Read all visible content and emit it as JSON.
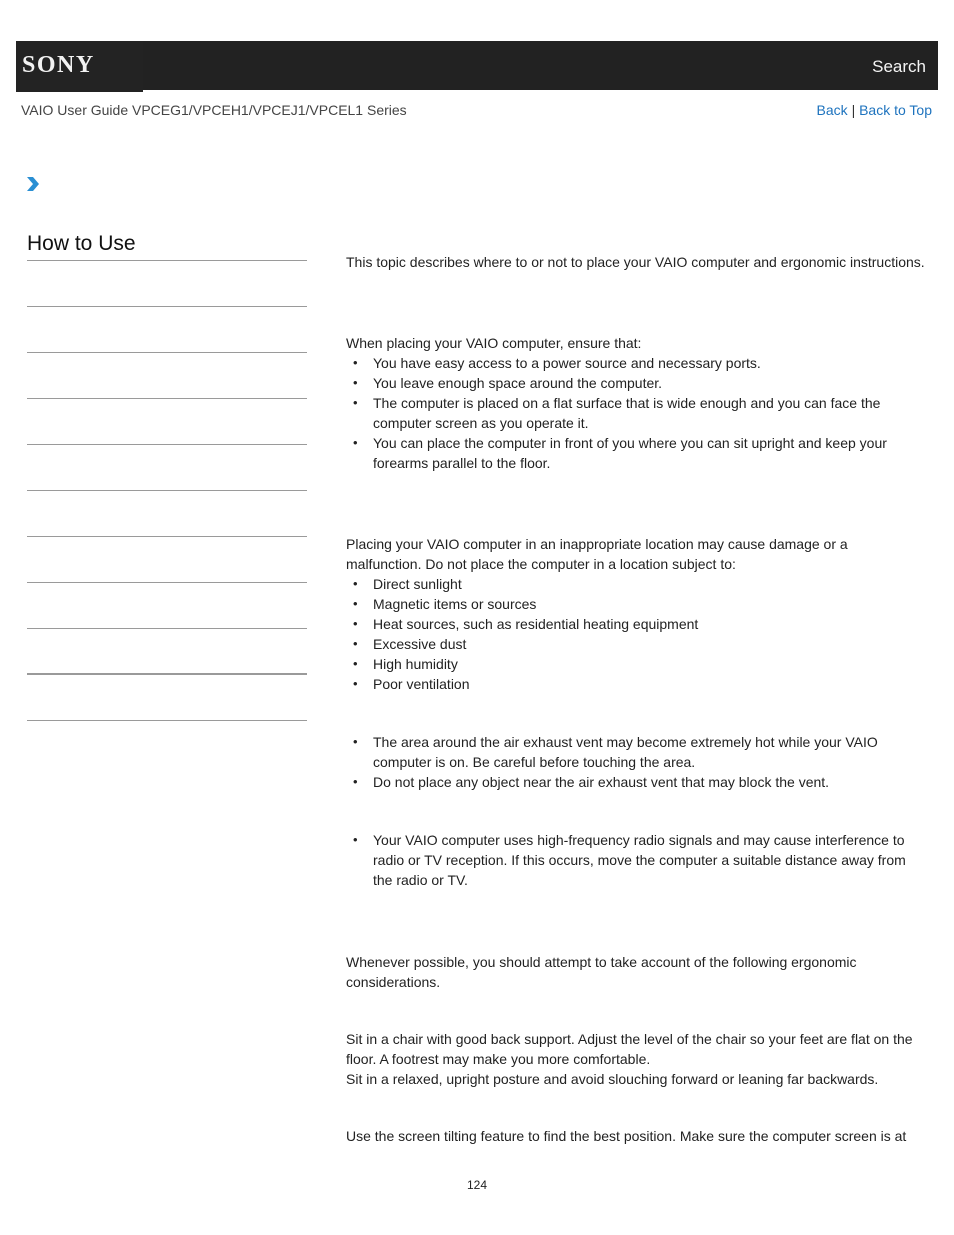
{
  "header": {
    "logo": "SONY",
    "search_label": "Search",
    "guide_title": "VAIO User Guide VPCEG1/VPCEH1/VPCEJ1/VPCEL1 Series",
    "back_label": "Back",
    "separator": "|",
    "back_to_top_label": "Back to Top"
  },
  "breadcrumb": {
    "icon": "chevron-right-icon"
  },
  "sidebar": {
    "title": "How to Use",
    "items": [
      "",
      "",
      "",
      "",
      "",
      "",
      "",
      "",
      "",
      ""
    ]
  },
  "content": {
    "intro": "This topic describes where to or not to place your VAIO computer and ergonomic instructions.",
    "placing_intro": "When placing your VAIO computer, ensure that:",
    "placing_items": [
      "You have easy access to a power source and necessary ports.",
      "You leave enough space around the computer.",
      "The computer is placed on a flat surface that is wide enough and you can face the computer screen as you operate it.",
      "You can place the computer in front of you where you can sit upright and keep your forearms parallel to the floor."
    ],
    "avoid_intro": "Placing your VAIO computer in an inappropriate location may cause damage or a malfunction. Do not place the computer in a location subject to:",
    "avoid_items": [
      "Direct sunlight",
      "Magnetic items or sources",
      "Heat sources, such as residential heating equipment",
      "Excessive dust",
      "High humidity",
      "Poor ventilation"
    ],
    "vent_items": [
      "The area around the air exhaust vent may become extremely hot while your VAIO computer is on. Be careful before touching the area.",
      "Do not place any object near the air exhaust vent that may block the vent."
    ],
    "radio_items": [
      "Your VAIO computer uses high-frequency radio signals and may cause interference to radio or TV reception. If this occurs, move the computer a suitable distance away from the radio or TV."
    ],
    "ergonomic_intro": "Whenever possible, you should attempt to take account of the following ergonomic considerations.",
    "chair_1": "Sit in a chair with good back support. Adjust the level of the chair so your feet are flat on the floor. A footrest may make you more comfortable.",
    "chair_2": "Sit in a relaxed, upright posture and avoid slouching forward or leaning far backwards.",
    "screen": "Use the screen tilting feature to find the best position. Make sure the computer screen is at"
  },
  "footer": {
    "page_number": "124"
  }
}
